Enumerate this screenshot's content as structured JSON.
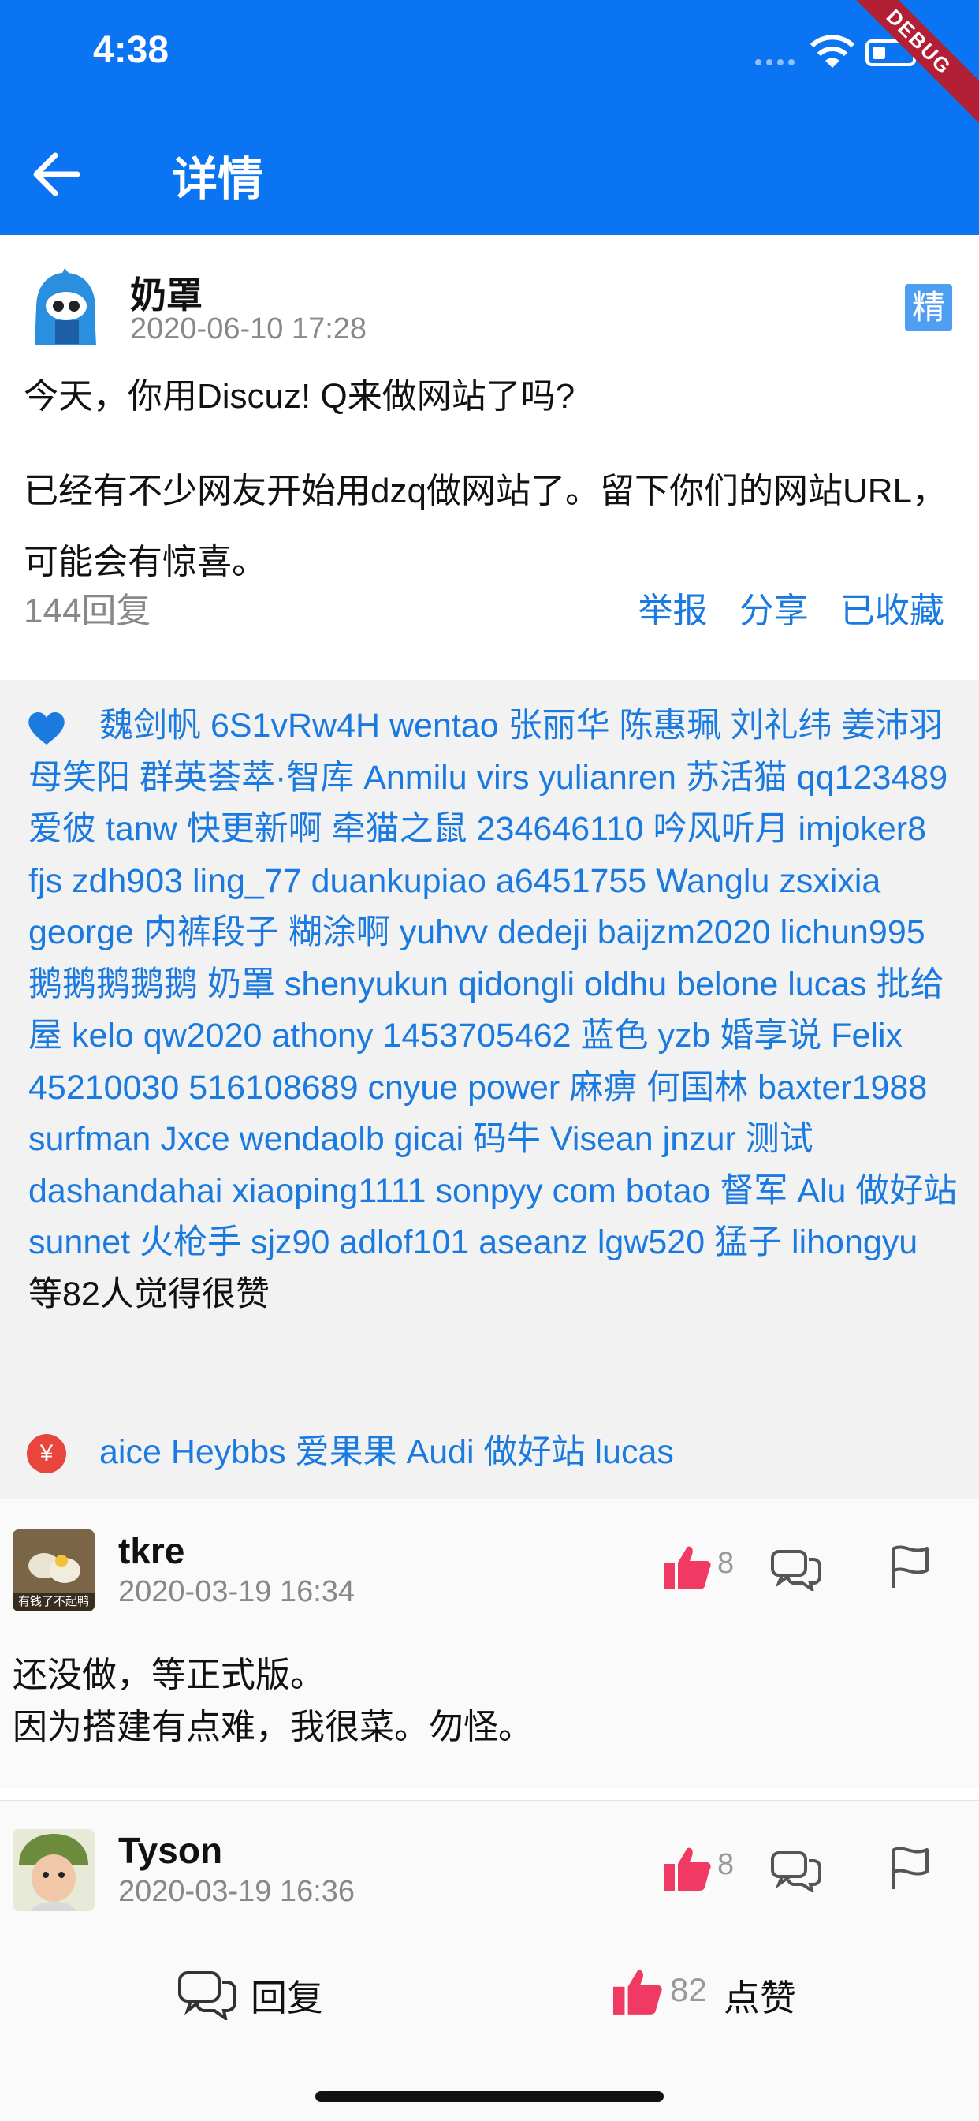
{
  "status": {
    "time": "4:38"
  },
  "debug_banner": "DEBUG",
  "appbar": {
    "title": "详情"
  },
  "post": {
    "author": "奶罩",
    "time": "2020-06-10 17:28",
    "essence_badge": "精",
    "title": "今天，你用Discuz! Q来做网站了吗?",
    "body": "已经有不少网友开始用dzq做网站了。留下你们的网站URL，可能会有惊喜。",
    "reply_count": "144回复",
    "actions": {
      "report": "举报",
      "share": "分享",
      "favorited": "已收藏"
    }
  },
  "likes": {
    "names": "魏剑帆 6S1vRw4H wentao 张丽华 陈惠珮 刘礼纬 姜沛羽 母笑阳 群英荟萃·智库 Anmilu virs yulianren 苏活猫 qq123489 爱彼 tanw 快更新啊 牵猫之鼠 234646110 吟风听月 imjoker8 fjs zdh903 ling_77 duankupiao a6451755 Wanglu zsxixia george 内裤段子 糊涂啊 yuhvv dedeji baijzm2020 lichun995 鹅鹅鹅鹅鹅 奶罩 shenyukun qidongli oldhu belone lucas 批给屋 kelo qw2020 athony 1453705462 蓝色 yzb 婚享说 Felix 45210030 516108689 cnyue power 麻痹 何国林 baxter1988 surfman Jxce wendaolb gicai 码牛 Visean jnzur 测试 dashandahai xiaoping1111 sonpyy com botao 督军 Alu 做好站 sunnet 火枪手 sjz90 adlof101 aseanz lgw520 猛子 lihongyu",
    "suffix": "等82人觉得很赞",
    "reward_symbol": "¥",
    "reward_names": "aice Heybbs 爱果果 Audi 做好站 lucas"
  },
  "comments": [
    {
      "name": "tkre",
      "time": "2020-03-19 16:34",
      "likes": "8",
      "avatar_caption": "有钱了不起鸭",
      "text_line1": "还没做，等正式版。",
      "text_line2": "因为搭建有点难，我很菜。勿怪。"
    },
    {
      "name": "Tyson",
      "time": "2020-03-19 16:36",
      "likes": "8"
    }
  ],
  "bottom_bar": {
    "reply_label": "回复",
    "like_count": "82",
    "like_label": "点赞"
  },
  "colors": {
    "appbar": "#0a74f2",
    "link": "#1a7ae0",
    "like_pink": "#f03a64",
    "essence": "#4e9ef2",
    "debug": "#b31f34"
  },
  "icons": {
    "back": "arrow-left-icon",
    "heart": "heart-icon",
    "reward": "yen-icon",
    "thumb": "thumbs-up-icon",
    "reply": "chat-bubbles-icon",
    "flag": "flag-icon",
    "wifi": "wifi-icon",
    "battery": "battery-icon"
  }
}
